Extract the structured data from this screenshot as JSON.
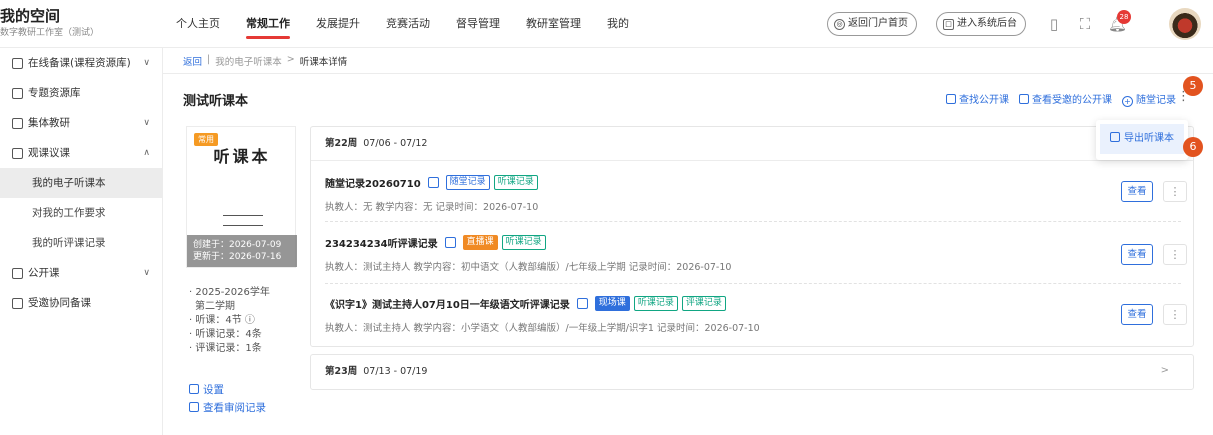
{
  "brand": {
    "title": "我的空间",
    "subtitle": "数字教研工作室（测试）"
  },
  "nav": [
    "个人主页",
    "常规工作",
    "发展提升",
    "竞赛活动",
    "督导管理",
    "教研室管理",
    "我的"
  ],
  "top_actions": {
    "portal": "返回门户首页",
    "backend": "进入系统后台",
    "notify_count": "28"
  },
  "sidebar": {
    "items": [
      {
        "label": "在线备课(课程资源库)",
        "chevron": "∨"
      },
      {
        "label": "专题资源库",
        "chevron": ""
      },
      {
        "label": "集体教研",
        "chevron": "∨"
      },
      {
        "label": "观课议课",
        "chevron": "∧"
      }
    ],
    "subitems": [
      "我的电子听课本",
      "对我的工作要求",
      "我的听评课记录"
    ],
    "items2": [
      {
        "label": "公开课",
        "chevron": "∨"
      },
      {
        "label": "受邀协同备课",
        "chevron": ""
      }
    ]
  },
  "breadcrumb": {
    "back": "返回",
    "sep": "|",
    "parent": "我的电子听课本",
    "arrow": ">",
    "current": "听课本详情"
  },
  "page_title": "测试听课本",
  "header_links": {
    "find": "查找公开课",
    "invited": "查看受邀的公开课",
    "record": "随堂记录"
  },
  "dropdown": {
    "export": "导出听课本"
  },
  "steps": {
    "five": "5",
    "six": "6"
  },
  "book": {
    "tag": "常用",
    "title": "听课本",
    "created": "创建于：2026-07-09",
    "updated": "更新于：2026-07-16",
    "info": [
      "· 2025-2026学年",
      "  第二学期",
      "· 听课：4节 ⓘ",
      "· 听课记录：4条",
      "· 评课记录：1条"
    ],
    "actions": {
      "settings": "设置",
      "review_log": "查看审阅记录"
    }
  },
  "weeks": [
    {
      "label": "第22周",
      "range": "07/06 - 07/12",
      "records": [
        {
          "title": "随堂记录20260710",
          "tags": [
            {
              "text": "随堂记录",
              "style": "blue"
            },
            {
              "text": "听课记录",
              "style": "green"
            }
          ],
          "meta": "执教人：无    教学内容：无    记录时间：2026-07-10"
        },
        {
          "title": "234234234听评课记录",
          "tags": [
            {
              "text": "直播课",
              "style": "orange"
            },
            {
              "text": "听课记录",
              "style": "green"
            }
          ],
          "meta": "执教人：测试主持人    教学内容：初中语文（人教部编版）/七年级上学期    记录时间：2026-07-10"
        },
        {
          "title": "《识字1》测试主持人07月10日一年级语文听评课记录",
          "tags": [
            {
              "text": "现场课",
              "style": "solidblue"
            },
            {
              "text": "听课记录",
              "style": "green"
            },
            {
              "text": "评课记录",
              "style": "green"
            }
          ],
          "meta": "执教人：测试主持人    教学内容：小学语文（人教部编版）/一年级上学期/识字1    记录时间：2026-07-10"
        }
      ],
      "view_label": "查看",
      "more": "⋮"
    },
    {
      "label": "第23周",
      "range": "07/13 - 07/19",
      "chevron": ">"
    }
  ]
}
